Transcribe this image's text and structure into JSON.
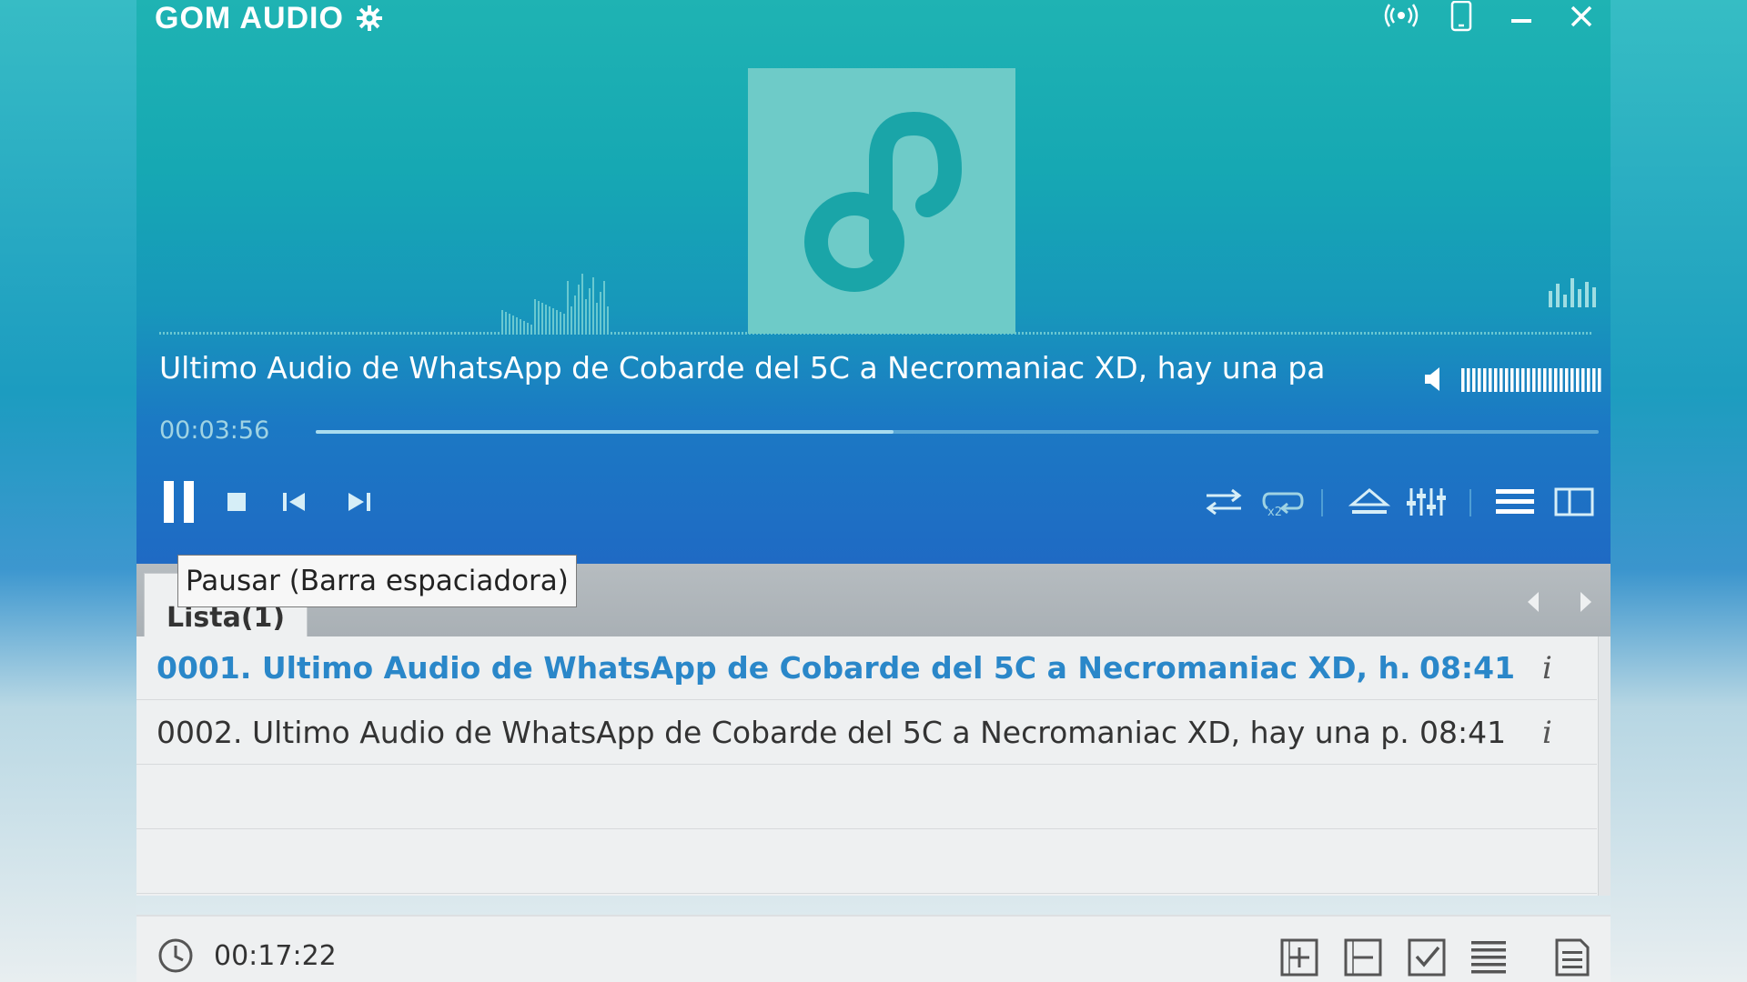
{
  "app": {
    "title": "GOM AUDIO"
  },
  "now_playing": {
    "title": "Ultimo Audio de WhatsApp de Cobarde del 5C a Necromaniac XD, hay una pa",
    "elapsed": "00:03:56",
    "progress": 0.45,
    "volume": 1.0
  },
  "tooltip": {
    "text": "Pausar (Barra espaciadora)"
  },
  "tabs": [
    {
      "label": "Lista(1)"
    }
  ],
  "playlist": [
    {
      "name": "0001. Ultimo Audio de WhatsApp de Cobarde del 5C a Necromaniac XD, h...",
      "duration": "08:41",
      "info": "i",
      "active": true
    },
    {
      "name": "0002. Ultimo Audio de WhatsApp de Cobarde del 5C a Necromaniac XD, hay una p...",
      "duration": "08:41",
      "info": "i",
      "active": false
    }
  ],
  "footer": {
    "total_time": "00:17:22"
  },
  "colors": {
    "accent": "#2a87c9",
    "top_gradient_start": "#1fb3b3",
    "top_gradient_end": "#1f6ac4"
  }
}
